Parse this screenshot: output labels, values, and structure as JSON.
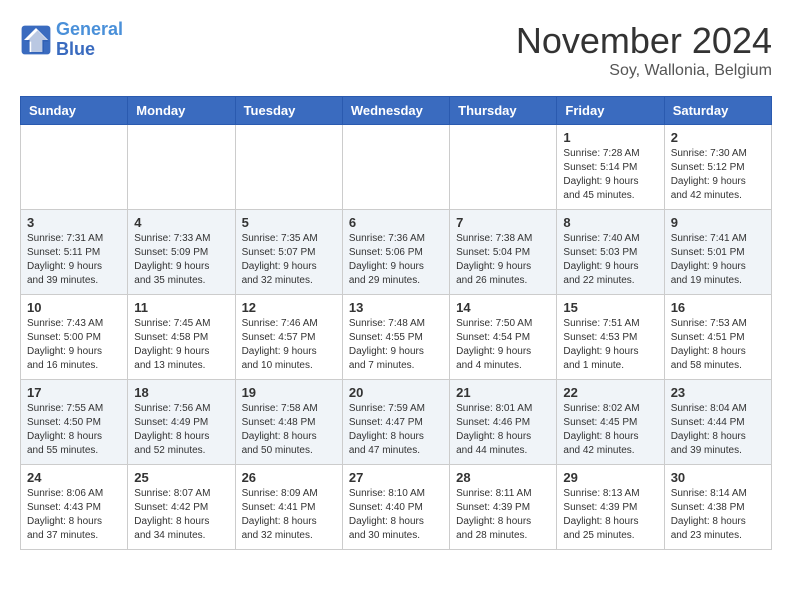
{
  "header": {
    "logo_line1": "General",
    "logo_line2": "Blue",
    "month_title": "November 2024",
    "location": "Soy, Wallonia, Belgium"
  },
  "weekdays": [
    "Sunday",
    "Monday",
    "Tuesday",
    "Wednesday",
    "Thursday",
    "Friday",
    "Saturday"
  ],
  "weeks": [
    [
      {
        "day": "",
        "info": ""
      },
      {
        "day": "",
        "info": ""
      },
      {
        "day": "",
        "info": ""
      },
      {
        "day": "",
        "info": ""
      },
      {
        "day": "",
        "info": ""
      },
      {
        "day": "1",
        "info": "Sunrise: 7:28 AM\nSunset: 5:14 PM\nDaylight: 9 hours\nand 45 minutes."
      },
      {
        "day": "2",
        "info": "Sunrise: 7:30 AM\nSunset: 5:12 PM\nDaylight: 9 hours\nand 42 minutes."
      }
    ],
    [
      {
        "day": "3",
        "info": "Sunrise: 7:31 AM\nSunset: 5:11 PM\nDaylight: 9 hours\nand 39 minutes."
      },
      {
        "day": "4",
        "info": "Sunrise: 7:33 AM\nSunset: 5:09 PM\nDaylight: 9 hours\nand 35 minutes."
      },
      {
        "day": "5",
        "info": "Sunrise: 7:35 AM\nSunset: 5:07 PM\nDaylight: 9 hours\nand 32 minutes."
      },
      {
        "day": "6",
        "info": "Sunrise: 7:36 AM\nSunset: 5:06 PM\nDaylight: 9 hours\nand 29 minutes."
      },
      {
        "day": "7",
        "info": "Sunrise: 7:38 AM\nSunset: 5:04 PM\nDaylight: 9 hours\nand 26 minutes."
      },
      {
        "day": "8",
        "info": "Sunrise: 7:40 AM\nSunset: 5:03 PM\nDaylight: 9 hours\nand 22 minutes."
      },
      {
        "day": "9",
        "info": "Sunrise: 7:41 AM\nSunset: 5:01 PM\nDaylight: 9 hours\nand 19 minutes."
      }
    ],
    [
      {
        "day": "10",
        "info": "Sunrise: 7:43 AM\nSunset: 5:00 PM\nDaylight: 9 hours\nand 16 minutes."
      },
      {
        "day": "11",
        "info": "Sunrise: 7:45 AM\nSunset: 4:58 PM\nDaylight: 9 hours\nand 13 minutes."
      },
      {
        "day": "12",
        "info": "Sunrise: 7:46 AM\nSunset: 4:57 PM\nDaylight: 9 hours\nand 10 minutes."
      },
      {
        "day": "13",
        "info": "Sunrise: 7:48 AM\nSunset: 4:55 PM\nDaylight: 9 hours\nand 7 minutes."
      },
      {
        "day": "14",
        "info": "Sunrise: 7:50 AM\nSunset: 4:54 PM\nDaylight: 9 hours\nand 4 minutes."
      },
      {
        "day": "15",
        "info": "Sunrise: 7:51 AM\nSunset: 4:53 PM\nDaylight: 9 hours\nand 1 minute."
      },
      {
        "day": "16",
        "info": "Sunrise: 7:53 AM\nSunset: 4:51 PM\nDaylight: 8 hours\nand 58 minutes."
      }
    ],
    [
      {
        "day": "17",
        "info": "Sunrise: 7:55 AM\nSunset: 4:50 PM\nDaylight: 8 hours\nand 55 minutes."
      },
      {
        "day": "18",
        "info": "Sunrise: 7:56 AM\nSunset: 4:49 PM\nDaylight: 8 hours\nand 52 minutes."
      },
      {
        "day": "19",
        "info": "Sunrise: 7:58 AM\nSunset: 4:48 PM\nDaylight: 8 hours\nand 50 minutes."
      },
      {
        "day": "20",
        "info": "Sunrise: 7:59 AM\nSunset: 4:47 PM\nDaylight: 8 hours\nand 47 minutes."
      },
      {
        "day": "21",
        "info": "Sunrise: 8:01 AM\nSunset: 4:46 PM\nDaylight: 8 hours\nand 44 minutes."
      },
      {
        "day": "22",
        "info": "Sunrise: 8:02 AM\nSunset: 4:45 PM\nDaylight: 8 hours\nand 42 minutes."
      },
      {
        "day": "23",
        "info": "Sunrise: 8:04 AM\nSunset: 4:44 PM\nDaylight: 8 hours\nand 39 minutes."
      }
    ],
    [
      {
        "day": "24",
        "info": "Sunrise: 8:06 AM\nSunset: 4:43 PM\nDaylight: 8 hours\nand 37 minutes."
      },
      {
        "day": "25",
        "info": "Sunrise: 8:07 AM\nSunset: 4:42 PM\nDaylight: 8 hours\nand 34 minutes."
      },
      {
        "day": "26",
        "info": "Sunrise: 8:09 AM\nSunset: 4:41 PM\nDaylight: 8 hours\nand 32 minutes."
      },
      {
        "day": "27",
        "info": "Sunrise: 8:10 AM\nSunset: 4:40 PM\nDaylight: 8 hours\nand 30 minutes."
      },
      {
        "day": "28",
        "info": "Sunrise: 8:11 AM\nSunset: 4:39 PM\nDaylight: 8 hours\nand 28 minutes."
      },
      {
        "day": "29",
        "info": "Sunrise: 8:13 AM\nSunset: 4:39 PM\nDaylight: 8 hours\nand 25 minutes."
      },
      {
        "day": "30",
        "info": "Sunrise: 8:14 AM\nSunset: 4:38 PM\nDaylight: 8 hours\nand 23 minutes."
      }
    ]
  ]
}
